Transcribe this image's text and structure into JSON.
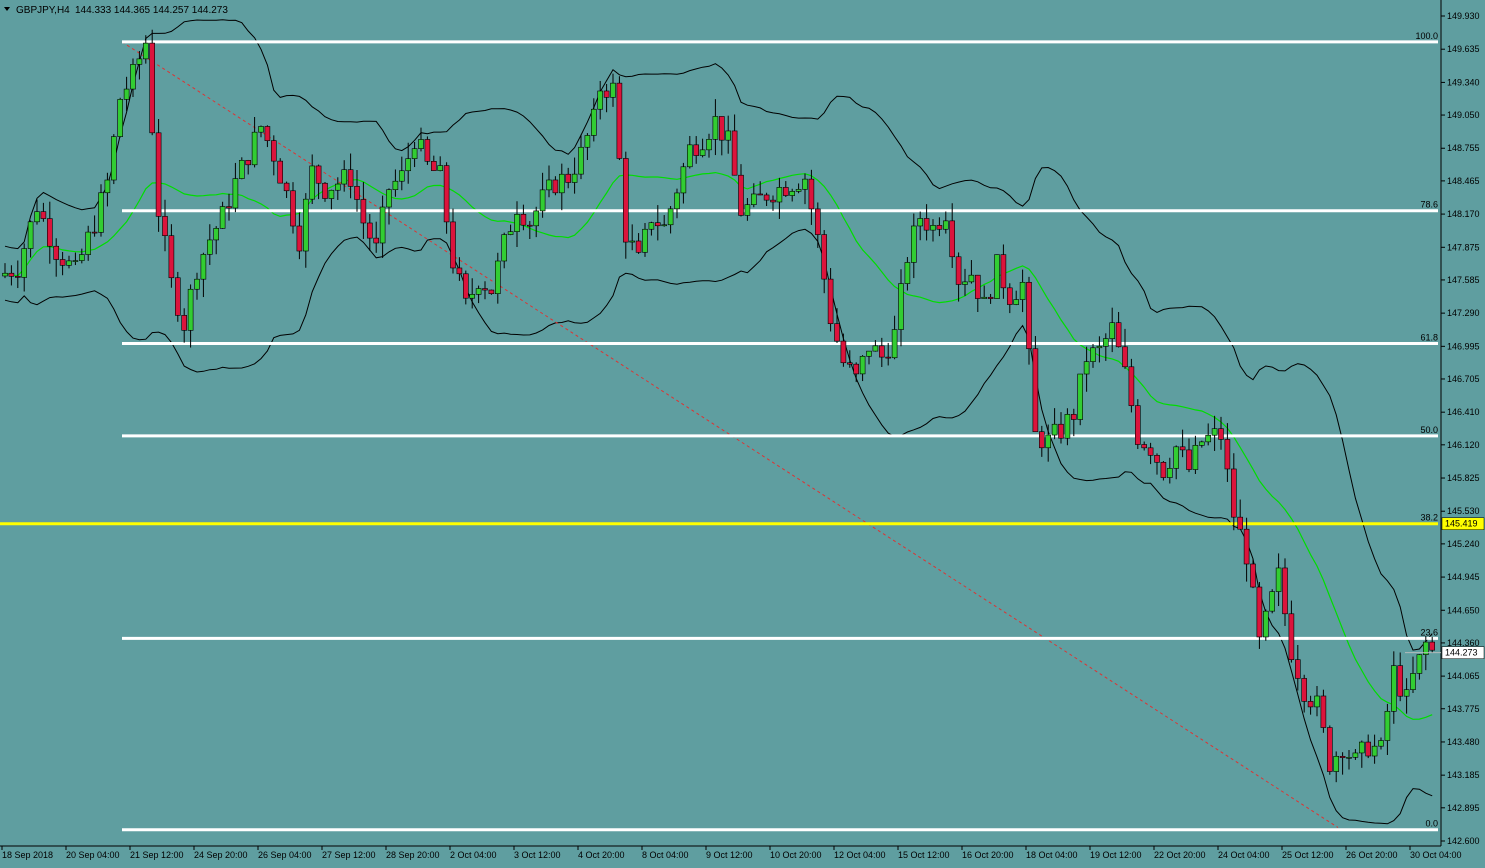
{
  "header": {
    "symbol": "GBPJPY,H4",
    "ohlc": "144.333 144.365 144.257 144.273"
  },
  "colors": {
    "background": "#5f9ea0",
    "bull_candle": "#32cd32",
    "bear_candle": "#dc143c",
    "band": "#000000",
    "ma": "#00dd00",
    "fib": "#ffffff",
    "highlight": "#ffff00",
    "trendline": "#dd3333"
  },
  "chart_data": {
    "type": "candlestick",
    "title": "GBPJPY,H4",
    "ylim": [
      142.6,
      150.03
    ],
    "y_ticks": [
      "149.930",
      "149.635",
      "149.340",
      "149.050",
      "148.755",
      "148.465",
      "148.170",
      "147.875",
      "147.585",
      "147.290",
      "146.995",
      "146.705",
      "146.410",
      "146.120",
      "145.825",
      "145.530",
      "145.240",
      "144.945",
      "144.650",
      "144.360",
      "144.065",
      "143.775",
      "143.480",
      "143.185",
      "142.895",
      "142.600"
    ],
    "x_ticks": [
      "18 Sep 2018",
      "20 Sep 04:00",
      "21 Sep 12:00",
      "24 Sep 20:00",
      "26 Sep 04:00",
      "27 Sep 12:00",
      "28 Sep 20:00",
      "2 Oct 04:00",
      "3 Oct 12:00",
      "4 Oct 20:00",
      "8 Oct 04:00",
      "9 Oct 12:00",
      "10 Oct 20:00",
      "12 Oct 04:00",
      "15 Oct 12:00",
      "16 Oct 20:00",
      "18 Oct 04:00",
      "19 Oct 12:00",
      "22 Oct 20:00",
      "24 Oct 04:00",
      "25 Oct 12:00",
      "26 Oct 20:00",
      "30 Oct 04:00"
    ],
    "current_price": "144.273",
    "highlight_price": "145.419",
    "fibonacci": [
      {
        "label": "100.0",
        "price": 149.7
      },
      {
        "label": "78.6",
        "price": 148.2
      },
      {
        "label": "61.8",
        "price": 147.02
      },
      {
        "label": "50.0",
        "price": 146.2
      },
      {
        "label": "38.2",
        "price": 145.419
      },
      {
        "label": "23.6",
        "price": 144.4
      },
      {
        "label": "0.0",
        "price": 142.7
      }
    ],
    "path_points": [
      [
        0,
        147.62
      ],
      [
        3,
        147.7
      ],
      [
        6,
        148.25
      ],
      [
        9,
        147.85
      ],
      [
        12,
        147.65
      ],
      [
        15,
        148.1
      ],
      [
        17,
        148.45
      ],
      [
        19,
        149.2
      ],
      [
        21,
        149.4
      ],
      [
        23,
        149.7
      ],
      [
        25,
        148.2
      ],
      [
        27,
        147.55
      ],
      [
        29,
        147.2
      ],
      [
        31,
        147.7
      ],
      [
        33,
        147.95
      ],
      [
        35,
        148.15
      ],
      [
        37,
        148.45
      ],
      [
        39,
        148.7
      ],
      [
        41,
        148.95
      ],
      [
        43,
        148.7
      ],
      [
        45,
        148.35
      ],
      [
        47,
        147.95
      ],
      [
        49,
        148.55
      ],
      [
        51,
        148.4
      ],
      [
        53,
        148.45
      ],
      [
        55,
        148.5
      ],
      [
        57,
        148.1
      ],
      [
        59,
        147.85
      ],
      [
        61,
        148.4
      ],
      [
        63,
        148.5
      ],
      [
        65,
        148.85
      ],
      [
        67,
        148.6
      ],
      [
        69,
        148.5
      ],
      [
        71,
        147.75
      ],
      [
        73,
        147.35
      ],
      [
        75,
        147.6
      ],
      [
        77,
        147.5
      ],
      [
        79,
        147.9
      ],
      [
        81,
        148.25
      ],
      [
        83,
        148.1
      ],
      [
        85,
        148.3
      ],
      [
        87,
        148.45
      ],
      [
        89,
        148.5
      ],
      [
        91,
        148.7
      ],
      [
        93,
        149.0
      ],
      [
        94,
        149.3
      ],
      [
        96,
        149.28
      ],
      [
        98,
        148.0
      ],
      [
        100,
        147.75
      ],
      [
        102,
        148.15
      ],
      [
        104,
        148.05
      ],
      [
        106,
        148.4
      ],
      [
        108,
        148.75
      ],
      [
        110,
        148.85
      ],
      [
        112,
        149.0
      ],
      [
        114,
        148.8
      ],
      [
        116,
        148.2
      ],
      [
        118,
        148.25
      ],
      [
        120,
        148.35
      ],
      [
        122,
        148.4
      ],
      [
        124,
        148.45
      ],
      [
        126,
        148.5
      ],
      [
        128,
        147.95
      ],
      [
        130,
        147.25
      ],
      [
        132,
        146.85
      ],
      [
        134,
        146.7
      ],
      [
        136,
        147.0
      ],
      [
        138,
        146.9
      ],
      [
        140,
        147.1
      ],
      [
        142,
        147.8
      ],
      [
        144,
        148.15
      ],
      [
        146,
        148.05
      ],
      [
        148,
        148.2
      ],
      [
        150,
        147.6
      ],
      [
        152,
        147.65
      ],
      [
        154,
        147.35
      ],
      [
        156,
        147.7
      ],
      [
        158,
        147.45
      ],
      [
        160,
        147.55
      ],
      [
        162,
        146.2
      ],
      [
        164,
        146.15
      ],
      [
        166,
        146.25
      ],
      [
        168,
        146.4
      ],
      [
        170,
        146.9
      ],
      [
        172,
        146.95
      ],
      [
        174,
        147.15
      ],
      [
        176,
        146.75
      ],
      [
        178,
        146.2
      ],
      [
        180,
        146.1
      ],
      [
        182,
        145.9
      ],
      [
        184,
        146.1
      ],
      [
        186,
        145.9
      ],
      [
        188,
        146.15
      ],
      [
        190,
        146.2
      ],
      [
        191,
        146.2
      ],
      [
        193,
        145.5
      ],
      [
        195,
        145.15
      ],
      [
        197,
        144.35
      ],
      [
        199,
        144.75
      ],
      [
        200,
        144.95
      ],
      [
        202,
        144.3
      ],
      [
        204,
        143.95
      ],
      [
        206,
        143.8
      ],
      [
        208,
        143.3
      ],
      [
        210,
        143.45
      ],
      [
        212,
        143.3
      ],
      [
        214,
        143.45
      ],
      [
        216,
        143.4
      ],
      [
        218,
        144.1
      ],
      [
        220,
        143.85
      ],
      [
        221,
        144.05
      ],
      [
        223,
        144.35
      ],
      [
        224,
        144.28
      ]
    ],
    "candle_count": 224,
    "indicators": {
      "bollinger_bands": {
        "period": 20,
        "deviations": 2
      },
      "moving_average": {
        "period": 20
      }
    }
  }
}
